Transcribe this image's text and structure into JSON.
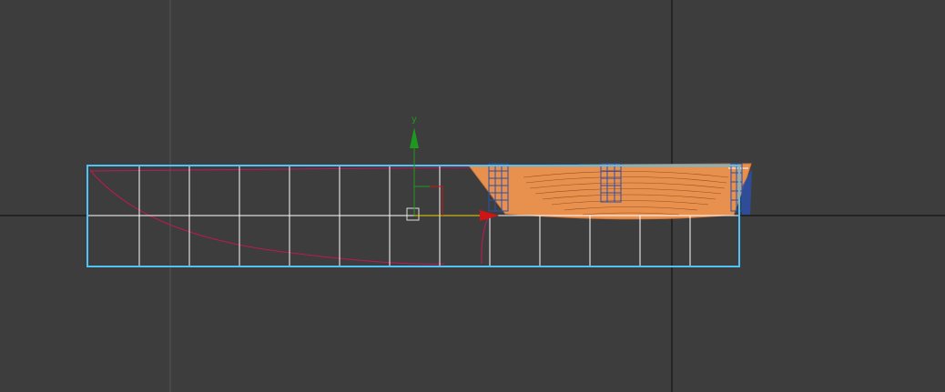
{
  "viewport": {
    "view": "front",
    "background_color": "#3d3d3d",
    "grid_line_color": "#555555",
    "axis_line_color": "#0b0b0b"
  },
  "selection": {
    "object_name": "",
    "bounding_color": "#4fc3f7",
    "grid_color": "#ffffff"
  },
  "gizmo": {
    "y_axis_label": "y",
    "y_axis_color": "#1d9a1d",
    "x_axis_color": "#d01414",
    "xy_plane_color": "#e8d400"
  },
  "hull": {
    "fill_color": "#e8914f",
    "contour_color": "#7a3a14",
    "frame_color": "#2b4fa8",
    "profile_curve_color": "#c1185a"
  },
  "icons": {
    "pivot": "pivot-square-icon",
    "move": "move-gizmo-icon"
  }
}
